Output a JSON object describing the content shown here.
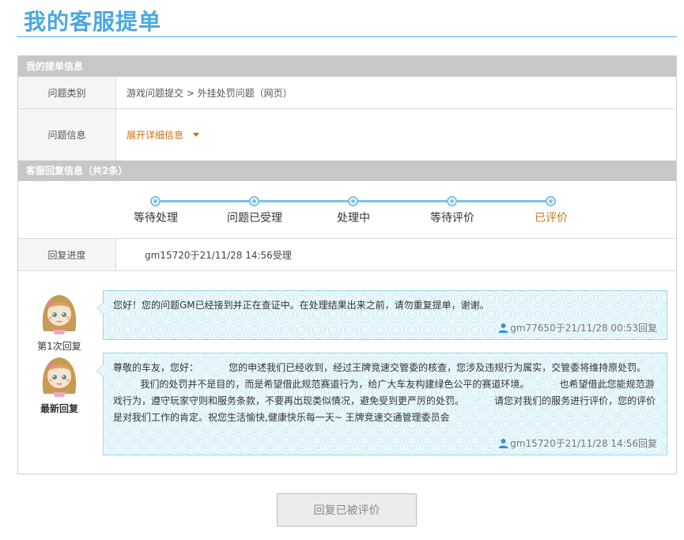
{
  "page": {
    "title": "我的客服提单"
  },
  "sections": {
    "ticket_info": "我的提单信息",
    "reply_info": "客服回复信息（共2条）"
  },
  "ticket": {
    "category_label": "问题类别",
    "category_value": "游戏问题提交 > 外挂处罚问题（网页）",
    "info_label": "问题信息",
    "expand_text": "展开详细信息"
  },
  "progress": {
    "steps": [
      "等待处理",
      "问题已受理",
      "处理中",
      "等待评价",
      "已评价"
    ],
    "current_step_index": 4
  },
  "reply_progress": {
    "label": "回复进度",
    "value": "gm15720于21/11/28 14:56受理"
  },
  "replies": [
    {
      "caption": "第1次回复",
      "text": "您好！您的问题GM已经接到并正在查证中。在处理结果出来之前，请勿重复提单，谢谢。",
      "meta": "gm77650于21/11/28 00:53回复"
    },
    {
      "caption": "最新回复",
      "text": "尊敬的车友，您好：          您的申述我们已经收到，经过王牌竞速交管委的核查，您涉及违规行为属实，交管委将维持原处罚。\n         我们的处罚并不是目的，而是希望借此规范赛道行为，给广大车友构建绿色公平的赛道环境。          也希望借此您能规范游戏行为，遵守玩家守则和服务条款，不要再出现类似情况，避免受到更严厉的处罚。          请您对我们的服务进行评价，您的评价是对我们工作的肯定。祝您生活愉快,健康快乐每一天~ 王牌竞速交通管理委员会",
      "meta": "gm15720于21/11/28 14:56回复"
    }
  ],
  "footer": {
    "button_label": "回复已被评价"
  },
  "colors": {
    "accent": "#4aa8e0",
    "link": "#d06a12",
    "done_step": "#c07a1a",
    "bubble_border": "#9fd6ea"
  },
  "icons": {
    "avatar": "girl-avatar-icon",
    "user": "user-icon",
    "caret": "caret-down-icon"
  }
}
